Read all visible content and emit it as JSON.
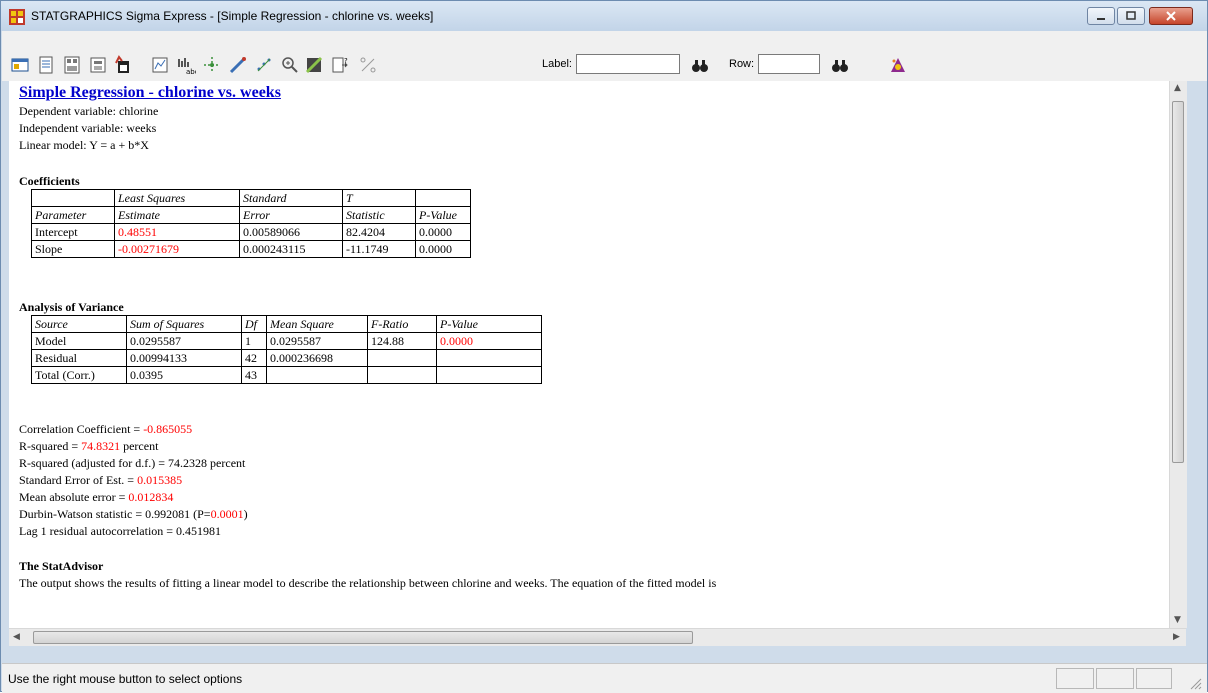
{
  "window": {
    "title": "STATGRAPHICS Sigma Express - [Simple Regression - chlorine vs. weeks]"
  },
  "toolbar": {
    "label_caption": "Label:",
    "label_value": "",
    "row_caption": "Row:",
    "row_value": "",
    "icons": [
      "analysis-options-icon",
      "tables-icon",
      "graphs-icon",
      "save-results-icon",
      "copy-icon",
      "exclude-icon",
      "label-icon",
      "brush-icon",
      "locate-icon",
      "zoom-icon",
      "jitter-icon",
      "add-point-icon",
      "filter-icon",
      "label-search-icon",
      "row-search-icon",
      "statadvisor-icon"
    ]
  },
  "report": {
    "heading": "Simple Regression - chlorine vs. weeks",
    "dependent": "Dependent variable: chlorine",
    "independent": "Independent variable: weeks",
    "model": "Linear model: Y = a + b*X",
    "coefficients_title": "Coefficients",
    "coefficients": {
      "header1": [
        "",
        "Least Squares",
        "Standard",
        "T",
        ""
      ],
      "header2": [
        "Parameter",
        "Estimate",
        "Error",
        "Statistic",
        "P-Value"
      ],
      "rows": [
        [
          "Intercept",
          "0.48551",
          "0.00589066",
          "82.4204",
          "0.0000"
        ],
        [
          "Slope",
          "-0.00271679",
          "0.000243115",
          "-11.1749",
          "0.0000"
        ]
      ]
    },
    "anova_title": "Analysis of Variance",
    "anova": {
      "header": [
        "Source",
        "Sum of Squares",
        "Df",
        "Mean Square",
        "F-Ratio",
        "P-Value"
      ],
      "rows": [
        [
          "Model",
          "0.0295587",
          "1",
          "0.0295587",
          "124.88",
          "0.0000"
        ],
        [
          "Residual",
          "0.00994133",
          "42",
          "0.000236698",
          "",
          ""
        ],
        [
          "Total (Corr.)",
          "0.0395",
          "43",
          "",
          "",
          ""
        ]
      ]
    },
    "stats": {
      "corr_label": "Correlation Coefficient = ",
      "corr_value": "-0.865055",
      "rsq_label": "R-squared = ",
      "rsq_value": "74.8321",
      "rsq_suffix": " percent",
      "rsq_adj": "R-squared (adjusted for d.f.) = 74.2328 percent",
      "se_label": "Standard Error of Est. = ",
      "se_value": "0.015385",
      "mae_label": "Mean absolute error = ",
      "mae_value": "0.012834",
      "dw_label": "Durbin-Watson statistic = 0.992081 (P=",
      "dw_value": "0.0001",
      "dw_suffix": ")",
      "lag": "Lag 1 residual autocorrelation = 0.451981"
    },
    "statadvisor_title": "The StatAdvisor",
    "statadvisor_text": "The output shows the results of fitting a linear model to describe the relationship between chlorine and weeks.  The equation of the fitted model is"
  },
  "status": {
    "text": "Use the right mouse button to select options"
  },
  "colors": {
    "highlight": "#ff0000",
    "heading": "#0000cc"
  }
}
